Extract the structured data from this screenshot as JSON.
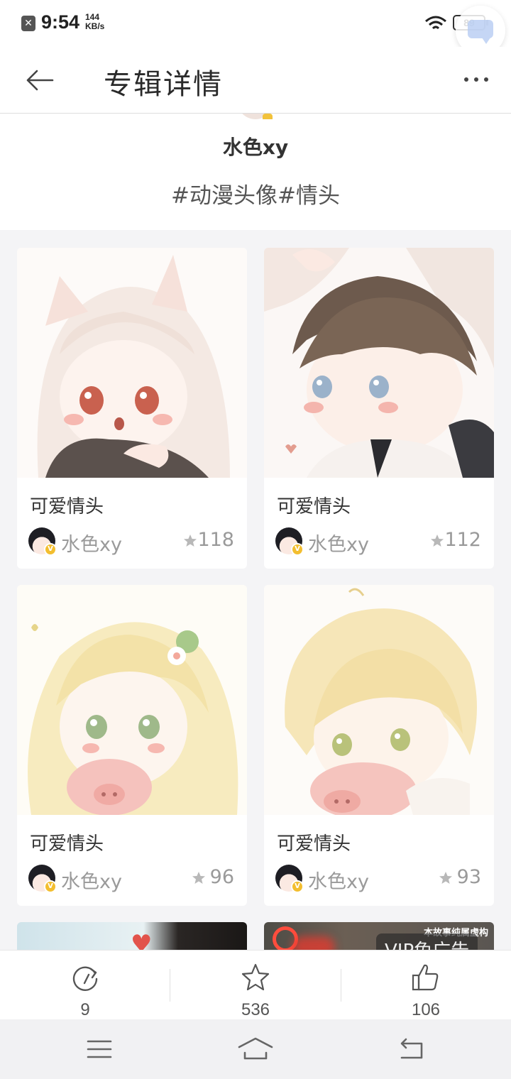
{
  "status_bar": {
    "time": "9:54",
    "speed_value": "144",
    "speed_unit": "KB/s",
    "battery": "89"
  },
  "nav": {
    "title": "专辑详情"
  },
  "album": {
    "author": "水色xy",
    "tags": "#动漫头像#情头"
  },
  "cards": [
    {
      "title": "可爱情头",
      "user": "水色xy",
      "likes": "118"
    },
    {
      "title": "可爱情头",
      "user": "水色xy",
      "likes": "112"
    },
    {
      "title": "可爱情头",
      "user": "水色xy",
      "likes": "96"
    },
    {
      "title": "可爱情头",
      "user": "水色xy",
      "likes": "93"
    }
  ],
  "partial_cards": {
    "right_notice": "本故事纯属虚构",
    "right_ad": "VIP免广告"
  },
  "actions": {
    "share_count": "9",
    "favorite_count": "536",
    "like_count": "106"
  },
  "icons": {
    "back": "arrow-left-icon",
    "more": "more-dots-icon",
    "share": "share-icon",
    "favorite": "star-icon",
    "like": "thumbs-up-icon",
    "menu": "menu-icon",
    "home": "home-icon",
    "back_nav": "return-icon"
  }
}
